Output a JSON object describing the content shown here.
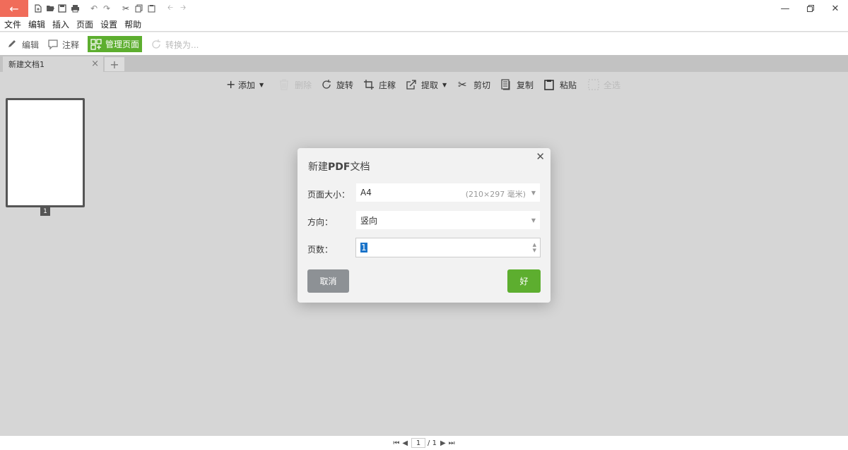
{
  "menubar": [
    "文件",
    "编辑",
    "插入",
    "页面",
    "设置",
    "帮助"
  ],
  "main_toolbar": {
    "edit": "编辑",
    "annotate": "注释",
    "manage_pages": "管理页面",
    "convert": "转换为..."
  },
  "tab": {
    "title": "新建文档1",
    "close": "×",
    "add": "+"
  },
  "page_toolbar": {
    "add": "添加",
    "delete": "删除",
    "rotate": "旋转",
    "crop": "庄稼",
    "extract": "提取",
    "cut": "剪切",
    "copy": "复制",
    "paste": "粘贴",
    "select_all": "全选"
  },
  "thumbnail": {
    "page_number": "1"
  },
  "dialog": {
    "title_prefix": "新建",
    "title_bold": "PDF",
    "title_suffix": "文档",
    "page_size_label": "页面大小：",
    "page_size_value": "A4",
    "page_size_hint": "(210×297 毫米)",
    "orientation_label": "方向：",
    "orientation_value": "竖向",
    "pages_label": "页数：",
    "pages_value": "1",
    "cancel": "取消",
    "ok": "好"
  },
  "status": {
    "current_page": "1",
    "total": "/ 1"
  },
  "colors": {
    "accent_green": "#5dae2f",
    "back_button": "#f06c5a"
  }
}
